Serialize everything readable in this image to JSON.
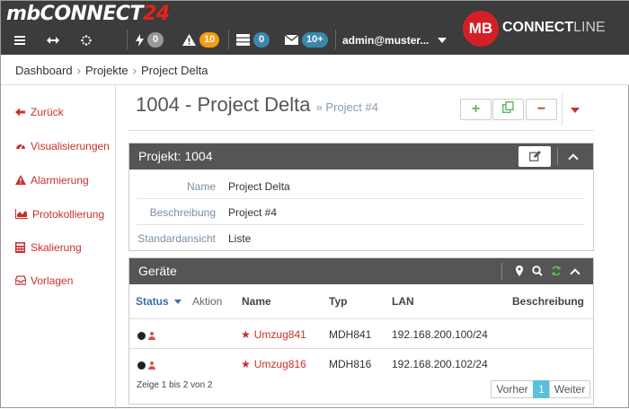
{
  "app": {
    "logo_main": "mbCONNECT",
    "logo_accent": "24",
    "brand_mb": "MB",
    "brand_connect": "CONNECT",
    "brand_line": "LINE"
  },
  "toolbar": {
    "menu_icon": "hamburger-icon",
    "badges": {
      "events": "0",
      "alarms": "10",
      "devices": "0",
      "messages": "10+"
    },
    "user": "admin@muster..."
  },
  "breadcrumb": [
    "Dashboard",
    "Projekte",
    "Project Delta"
  ],
  "sidebar": {
    "items": [
      {
        "label": "Zurück",
        "icon": "arrow-left-icon"
      },
      {
        "label": "Visualisierungen",
        "icon": "dashboard-icon"
      },
      {
        "label": "Alarmierung",
        "icon": "warning-icon"
      },
      {
        "label": "Protokollierung",
        "icon": "area-chart-icon"
      },
      {
        "label": "Skalierung",
        "icon": "calculator-icon"
      },
      {
        "label": "Vorlagen",
        "icon": "inbox-icon"
      }
    ]
  },
  "page": {
    "title": "1004 - Project Delta",
    "subtitle": "» Project #4",
    "add": "+",
    "remove": "−"
  },
  "project_panel": {
    "title": "Projekt: 1004",
    "rows": [
      {
        "label": "Name",
        "value": "Project Delta"
      },
      {
        "label": "Beschreibung",
        "value": "Project #4"
      },
      {
        "label": "Standardansicht",
        "value": "Liste"
      }
    ]
  },
  "devices_panel": {
    "title": "Geräte",
    "columns": {
      "status": "Status",
      "action": "Aktion",
      "name": "Name",
      "type": "Typ",
      "lan": "LAN",
      "desc": "Beschreibung"
    },
    "rows": [
      {
        "name": "Umzug841",
        "type": "MDH841",
        "lan": "192.168.200.100/24",
        "desc": ""
      },
      {
        "name": "Umzug816",
        "type": "MDH816",
        "lan": "192.168.200.102/24",
        "desc": ""
      }
    ],
    "info": "Zeige 1 bis 2 von 2",
    "pager": {
      "prev": "Vorher",
      "page": "1",
      "next": "Weiter"
    }
  },
  "colors": {
    "accent_red": "#c9302c",
    "topbar": "#3c3c3c",
    "panel_head": "#555555",
    "badge_orange": "#f39c12",
    "badge_blue": "#3a87ad"
  }
}
